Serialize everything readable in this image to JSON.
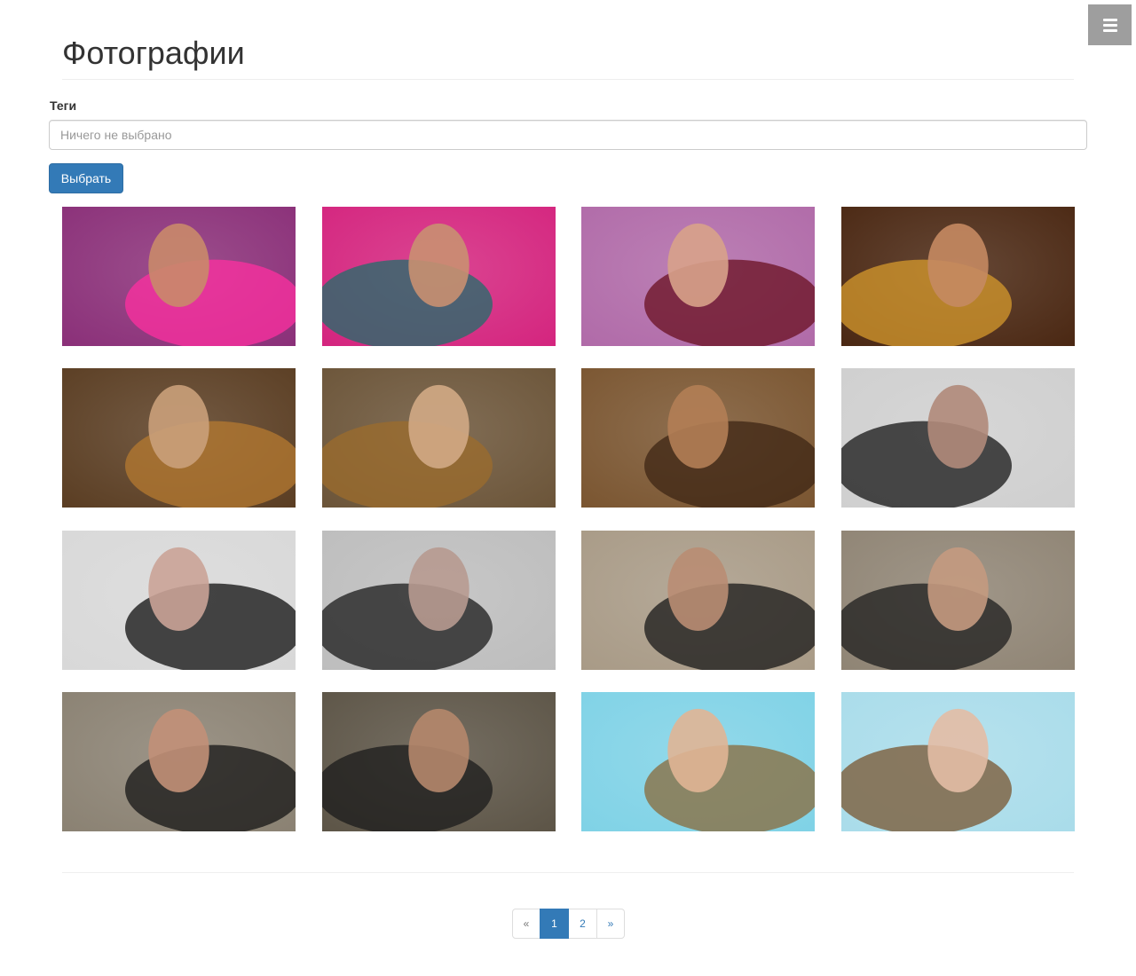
{
  "header": {
    "title": "Фотографии"
  },
  "menu": {
    "icon": "hamburger-icon"
  },
  "filter": {
    "label": "Теги",
    "placeholder": "Ничего не выбрано",
    "button_label": "Выбрать"
  },
  "colors": {
    "primary": "#337ab7",
    "menu_button": "#9e9e9e",
    "border": "#cccccc"
  },
  "photos": [
    {
      "bg": "#8a2f78",
      "accent": "#ff2fa0",
      "figure": "#c98a6a"
    },
    {
      "bg": "#d4247e",
      "accent": "#1f6f6a",
      "figure": "#c99071"
    },
    {
      "bg": "#b06aa8",
      "accent": "#6a1020",
      "figure": "#d8a28a"
    },
    {
      "bg": "#4a2712",
      "accent": "#d69a2c",
      "figure": "#c58a62"
    },
    {
      "bg": "#5a3d22",
      "accent": "#b57a30",
      "figure": "#caa07a"
    },
    {
      "bg": "#6b5438",
      "accent": "#9c6c2c",
      "figure": "#d2aa85"
    },
    {
      "bg": "#7a5530",
      "accent": "#3d2614",
      "figure": "#b27e55"
    },
    {
      "bg": "#cfcfcf",
      "accent": "#151515",
      "figure": "#b08a7a"
    },
    {
      "bg": "#d8d8d8",
      "accent": "#0f0f0f",
      "figure": "#caa397"
    },
    {
      "bg": "#bdbdbd",
      "accent": "#1a1a1a",
      "figure": "#b79a90"
    },
    {
      "bg": "#a89a86",
      "accent": "#181818",
      "figure": "#b98d73"
    },
    {
      "bg": "#8f8474",
      "accent": "#1d1d1d",
      "figure": "#c49a80"
    },
    {
      "bg": "#8a8172",
      "accent": "#161616",
      "figure": "#c29078"
    },
    {
      "bg": "#5c5446",
      "accent": "#1b1b1b",
      "figure": "#b5876b"
    },
    {
      "bg": "#7fd2e6",
      "accent": "#8a6a3a",
      "figure": "#e0b595"
    },
    {
      "bg": "#a9dcea",
      "accent": "#7a5530",
      "figure": "#e3bca5"
    }
  ],
  "pagination": {
    "prev": "«",
    "pages": [
      "1",
      "2"
    ],
    "current": "1",
    "next": "»"
  }
}
